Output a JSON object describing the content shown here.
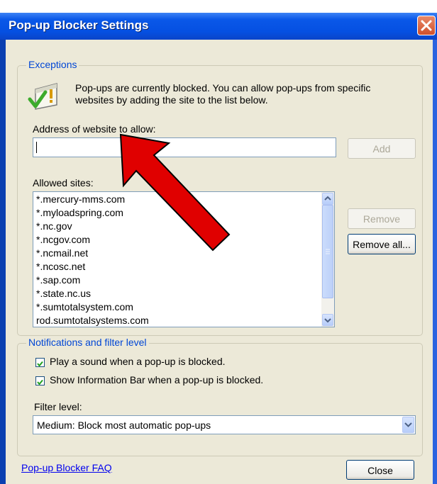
{
  "window": {
    "title": "Pop-up Blocker Settings"
  },
  "exceptions": {
    "group_title": "Exceptions",
    "info_line1": "Pop-ups are currently blocked.  You can allow pop-ups from specific",
    "info_line2": "websites by adding the site to the list below.",
    "address_label": "Address of website to allow:",
    "address_value": "",
    "add_label": "Add",
    "allowed_label": "Allowed sites:",
    "allowed_sites": [
      "*.mercury-mms.com",
      "*.myloadspring.com",
      "*.nc.gov",
      "*.ncgov.com",
      "*.ncmail.net",
      "*.ncosc.net",
      "*.sap.com",
      "*.state.nc.us",
      "*.sumtotalsystem.com",
      "rod.sumtotalsystems.com"
    ],
    "remove_label": "Remove",
    "remove_all_label": "Remove all..."
  },
  "notifications": {
    "group_title": "Notifications and filter level",
    "play_sound_label": "Play a sound when a pop-up is blocked.",
    "play_sound_checked": true,
    "show_infobar_label": "Show Information Bar when a pop-up is blocked.",
    "show_infobar_checked": true,
    "filter_label": "Filter level:",
    "filter_value": "Medium: Block most automatic pop-ups"
  },
  "footer": {
    "faq_link": "Pop-up Blocker FAQ",
    "close_label": "Close"
  },
  "colors": {
    "titlebar": "#0a58e8",
    "group_title": "#0046d5",
    "annotation_arrow": "#e00000"
  },
  "icons": [
    "close-icon",
    "popup-blocked-icon",
    "scroll-up-icon",
    "scroll-down-icon",
    "dropdown-arrow-icon",
    "checkmark-icon"
  ]
}
